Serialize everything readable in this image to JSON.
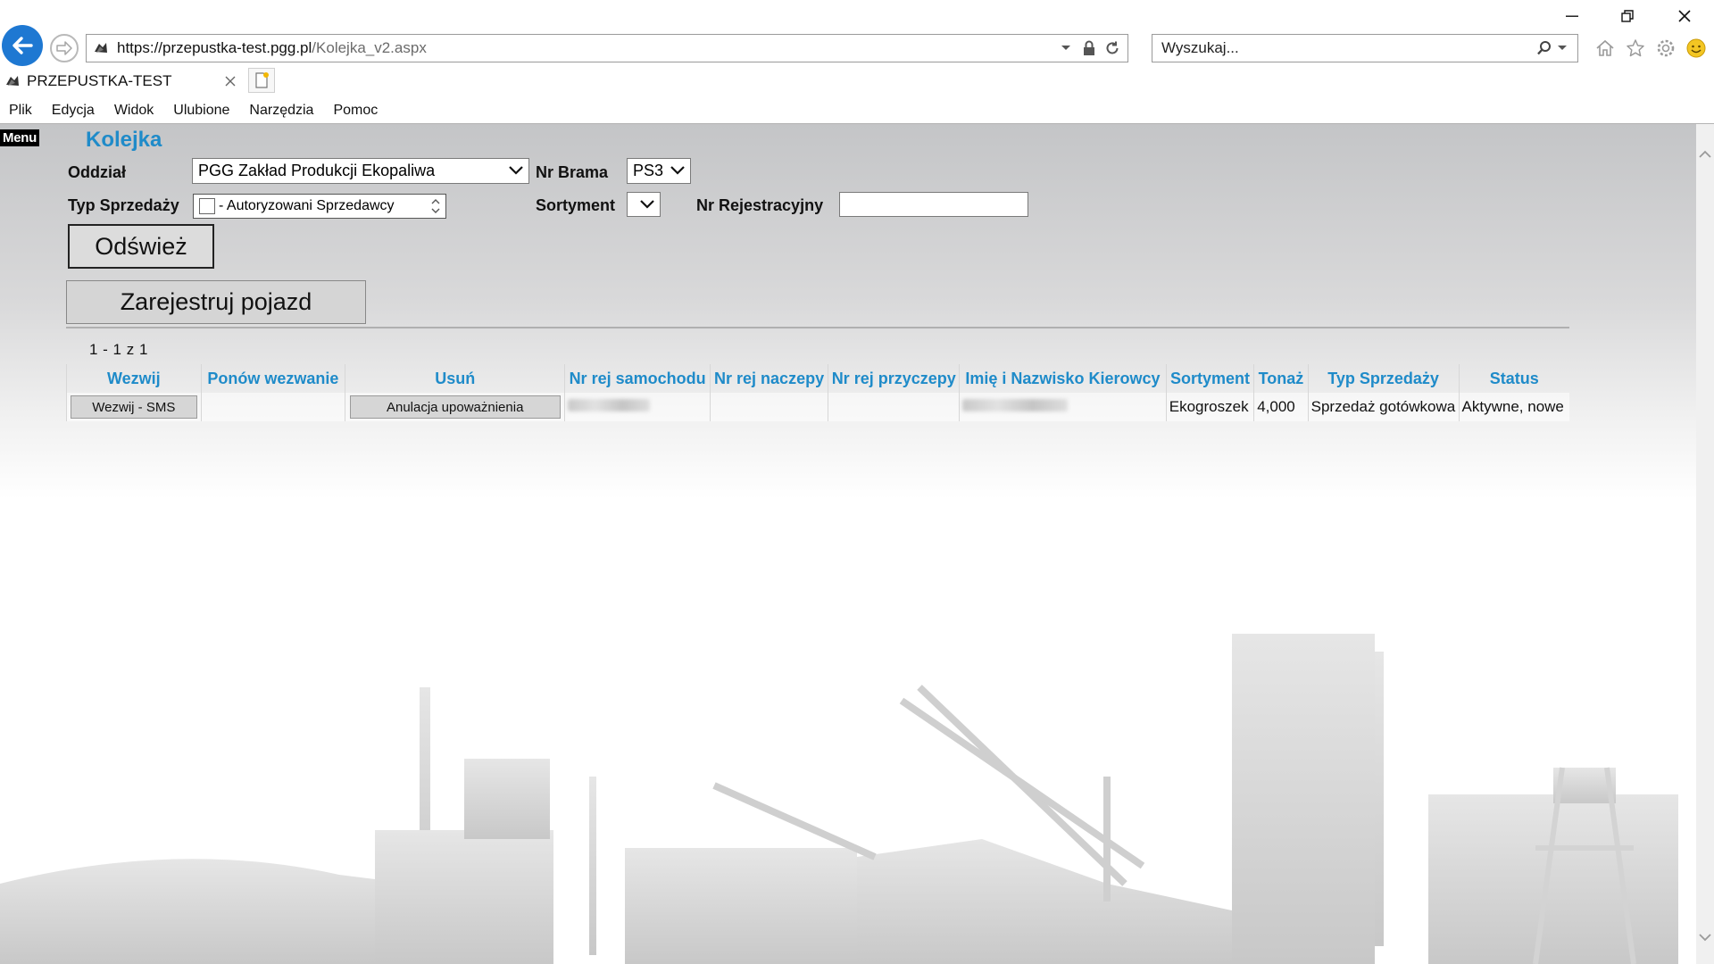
{
  "browser": {
    "url_prefix": "https://przepustka-test.",
    "url_domain": "pgg.pl",
    "url_path": "/Kolejka_v2.aspx",
    "search_placeholder": "Wyszukaj...",
    "tab_title": "PRZEPUSTKA-TEST",
    "menu": [
      "Plik",
      "Edycja",
      "Widok",
      "Ulubione",
      "Narzędzia",
      "Pomoc"
    ],
    "accent": "#1e78d2"
  },
  "page": {
    "menu_label": "Menu",
    "title": "Kolejka",
    "title_color": "#1f8bc9",
    "filters": {
      "oddzial_label": "Oddział",
      "oddzial_value": "PGG Zakład Produkcji Ekopaliwa",
      "brama_label": "Nr Brama",
      "brama_value": "PS3",
      "typ_label": "Typ Sprzedaży",
      "typ_value": "- Autoryzowani Sprzedawcy",
      "sortyment_label": "Sortyment",
      "sortyment_value": "",
      "nrrej_label": "Nr Rejestracyjny",
      "nrrej_value": ""
    },
    "refresh_label": "Odśwież",
    "register_label": "Zarejestruj pojazd",
    "pager": "1 - 1 z 1",
    "table": {
      "headers": [
        "Wezwij",
        "Ponów wezwanie",
        "Usuń",
        "Nr rej samochodu",
        "Nr rej naczepy",
        "Nr rej przyczepy",
        "Imię i Nazwisko Kierowcy",
        "Sortyment",
        "Tonaż",
        "Typ Sprzedaży",
        "Status"
      ],
      "rows": [
        {
          "wezwij_btn": "Wezwij - SMS",
          "ponow": "",
          "usun_btn": "Anulacja upoważnienia",
          "nr_rej_samochodu": "",
          "nr_rej_naczepy": "",
          "nr_rej_przyczepy": "",
          "kierowca": "",
          "sortyment": "Ekogroszek",
          "tonaz": "4,000",
          "typ_sprzedazy": "Sprzedaż gotówkowa",
          "status": "Aktywne, nowe"
        }
      ]
    }
  }
}
